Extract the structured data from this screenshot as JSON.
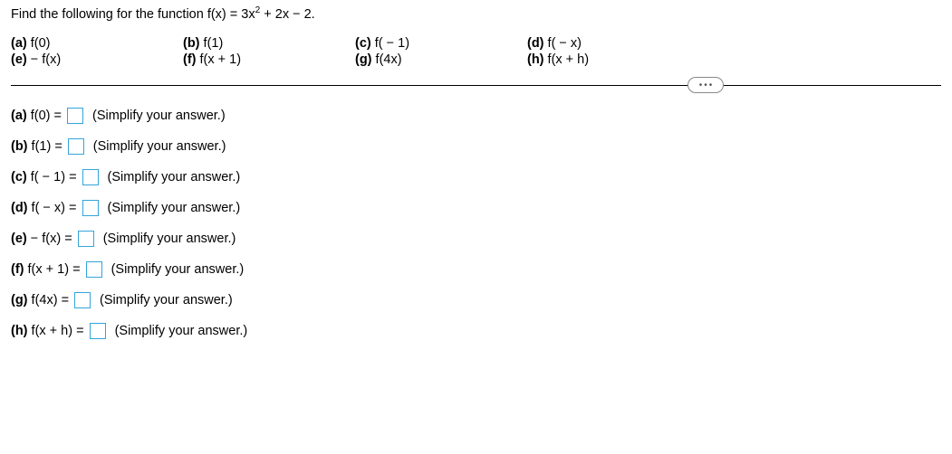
{
  "instruction_prefix": "Find the following for the function f(x) = 3x",
  "instruction_exp": "2",
  "instruction_suffix": " + 2x − 2.",
  "columns": [
    {
      "top_tag": "(a)",
      "top_expr": "f(0)",
      "bot_tag": "(e)",
      "bot_expr": " − f(x)"
    },
    {
      "top_tag": "(b)",
      "top_expr": "f(1)",
      "bot_tag": "(f)",
      "bot_expr": "f(x + 1)"
    },
    {
      "top_tag": "(c)",
      "top_expr": "f( − 1)",
      "bot_tag": "(g)",
      "bot_expr": "f(4x)"
    },
    {
      "top_tag": "(d)",
      "top_expr": "f( − x)",
      "bot_tag": "(h)",
      "bot_expr": "f(x + h)"
    }
  ],
  "more_label": "•••",
  "hint": "(Simplify your answer.)",
  "answers": [
    {
      "tag": "(a)",
      "lhs": "f(0) ="
    },
    {
      "tag": "(b)",
      "lhs": "f(1) ="
    },
    {
      "tag": "(c)",
      "lhs": "f( − 1) ="
    },
    {
      "tag": "(d)",
      "lhs": "f( − x) ="
    },
    {
      "tag": "(e)",
      "lhs": " − f(x) ="
    },
    {
      "tag": "(f)",
      "lhs": "f(x + 1) ="
    },
    {
      "tag": "(g)",
      "lhs": "f(4x) ="
    },
    {
      "tag": "(h)",
      "lhs": "f(x + h) ="
    }
  ]
}
